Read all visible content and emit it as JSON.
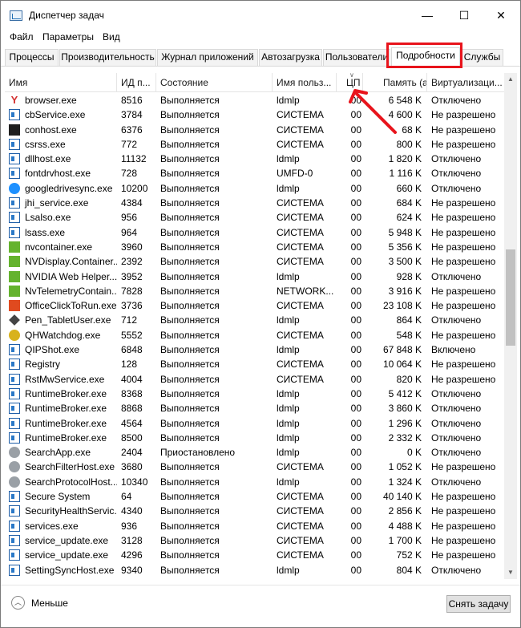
{
  "window": {
    "title": "Диспетчер задач",
    "close_glyph": "✕",
    "minimize_glyph": "—",
    "maximize_glyph": "☐"
  },
  "menu": [
    "Файл",
    "Параметры",
    "Вид"
  ],
  "tabs": [
    {
      "label": "Процессы"
    },
    {
      "label": "Производительность"
    },
    {
      "label": "Журнал приложений"
    },
    {
      "label": "Автозагрузка"
    },
    {
      "label": "Пользователи"
    },
    {
      "label": "Подробности",
      "active": true
    },
    {
      "label": "Службы"
    }
  ],
  "highlight_color": "#e8141c",
  "columns": {
    "name": "Имя",
    "pid": "ИД п...",
    "status": "Состояние",
    "user": "Имя польз...",
    "cpu": "ЦП",
    "memory": "Память (а...",
    "virt": "Виртуализаци..."
  },
  "processes": [
    {
      "icon": "yandex-browser-icon",
      "name": "browser.exe",
      "pid": "8516",
      "status": "Выполняется",
      "user": "ldmlp",
      "cpu": "00",
      "mem": "6 548 K",
      "virt": "Отключено"
    },
    {
      "icon": "exe-icon",
      "name": "cbService.exe",
      "pid": "3784",
      "status": "Выполняется",
      "user": "СИСТЕМА",
      "cpu": "00",
      "mem": "4 600 K",
      "virt": "Не разрешено"
    },
    {
      "icon": "console-icon",
      "name": "conhost.exe",
      "pid": "6376",
      "status": "Выполняется",
      "user": "СИСТЕМА",
      "cpu": "00",
      "mem": "68 K",
      "virt": "Не разрешено"
    },
    {
      "icon": "exe-icon",
      "name": "csrss.exe",
      "pid": "772",
      "status": "Выполняется",
      "user": "СИСТЕМА",
      "cpu": "00",
      "mem": "800 K",
      "virt": "Не разрешено"
    },
    {
      "icon": "exe-icon",
      "name": "dllhost.exe",
      "pid": "11132",
      "status": "Выполняется",
      "user": "ldmlp",
      "cpu": "00",
      "mem": "1 820 K",
      "virt": "Отключено"
    },
    {
      "icon": "exe-icon",
      "name": "fontdrvhost.exe",
      "pid": "728",
      "status": "Выполняется",
      "user": "UMFD-0",
      "cpu": "00",
      "mem": "1 116 K",
      "virt": "Отключено"
    },
    {
      "icon": "google-drive-icon",
      "name": "googledrivesync.exe",
      "pid": "10200",
      "status": "Выполняется",
      "user": "ldmlp",
      "cpu": "00",
      "mem": "660 K",
      "virt": "Отключено"
    },
    {
      "icon": "exe-icon",
      "name": "jhi_service.exe",
      "pid": "4384",
      "status": "Выполняется",
      "user": "СИСТЕМА",
      "cpu": "00",
      "mem": "684 K",
      "virt": "Не разрешено"
    },
    {
      "icon": "exe-icon",
      "name": "Lsalso.exe",
      "pid": "956",
      "status": "Выполняется",
      "user": "СИСТЕМА",
      "cpu": "00",
      "mem": "624 K",
      "virt": "Не разрешено"
    },
    {
      "icon": "exe-icon",
      "name": "lsass.exe",
      "pid": "964",
      "status": "Выполняется",
      "user": "СИСТЕМА",
      "cpu": "00",
      "mem": "5 948 K",
      "virt": "Не разрешено"
    },
    {
      "icon": "nvidia-icon",
      "name": "nvcontainer.exe",
      "pid": "3960",
      "status": "Выполняется",
      "user": "СИСТЕМА",
      "cpu": "00",
      "mem": "5 356 K",
      "virt": "Не разрешено"
    },
    {
      "icon": "nvidia-icon",
      "name": "NVDisplay.Container...",
      "pid": "2392",
      "status": "Выполняется",
      "user": "СИСТЕМА",
      "cpu": "00",
      "mem": "3 500 K",
      "virt": "Не разрешено"
    },
    {
      "icon": "nvidia-icon",
      "name": "NVIDIA Web Helper....",
      "pid": "3952",
      "status": "Выполняется",
      "user": "ldmlp",
      "cpu": "00",
      "mem": "928 K",
      "virt": "Отключено"
    },
    {
      "icon": "nvidia-icon",
      "name": "NvTelemetryContain...",
      "pid": "7828",
      "status": "Выполняется",
      "user": "NETWORK...",
      "cpu": "00",
      "mem": "3 916 K",
      "virt": "Не разрешено"
    },
    {
      "icon": "office-icon",
      "name": "OfficeClickToRun.exe",
      "pid": "3736",
      "status": "Выполняется",
      "user": "СИСТЕМА",
      "cpu": "00",
      "mem": "23 108 K",
      "virt": "Не разрешено"
    },
    {
      "icon": "pen-icon",
      "name": "Pen_TabletUser.exe",
      "pid": "712",
      "status": "Выполняется",
      "user": "ldmlp",
      "cpu": "00",
      "mem": "864 K",
      "virt": "Отключено"
    },
    {
      "icon": "qh-watchdog-icon",
      "name": "QHWatchdog.exe",
      "pid": "5552",
      "status": "Выполняется",
      "user": "СИСТЕМА",
      "cpu": "00",
      "mem": "548 K",
      "virt": "Не разрешено"
    },
    {
      "icon": "qipshot-icon",
      "name": "QIPShot.exe",
      "pid": "6848",
      "status": "Выполняется",
      "user": "ldmlp",
      "cpu": "00",
      "mem": "67 848 K",
      "virt": "Включено"
    },
    {
      "icon": "exe-icon",
      "name": "Registry",
      "pid": "128",
      "status": "Выполняется",
      "user": "СИСТЕМА",
      "cpu": "00",
      "mem": "10 064 K",
      "virt": "Не разрешено"
    },
    {
      "icon": "exe-icon",
      "name": "RstMwService.exe",
      "pid": "4004",
      "status": "Выполняется",
      "user": "СИСТЕМА",
      "cpu": "00",
      "mem": "820 K",
      "virt": "Не разрешено"
    },
    {
      "icon": "exe-icon",
      "name": "RuntimeBroker.exe",
      "pid": "8368",
      "status": "Выполняется",
      "user": "ldmlp",
      "cpu": "00",
      "mem": "5 412 K",
      "virt": "Отключено"
    },
    {
      "icon": "exe-icon",
      "name": "RuntimeBroker.exe",
      "pid": "8868",
      "status": "Выполняется",
      "user": "ldmlp",
      "cpu": "00",
      "mem": "3 860 K",
      "virt": "Отключено"
    },
    {
      "icon": "exe-icon",
      "name": "RuntimeBroker.exe",
      "pid": "4564",
      "status": "Выполняется",
      "user": "ldmlp",
      "cpu": "00",
      "mem": "1 296 K",
      "virt": "Отключено"
    },
    {
      "icon": "exe-icon",
      "name": "RuntimeBroker.exe",
      "pid": "8500",
      "status": "Выполняется",
      "user": "ldmlp",
      "cpu": "00",
      "mem": "2 332 K",
      "virt": "Отключено"
    },
    {
      "icon": "search-icon",
      "name": "SearchApp.exe",
      "pid": "2404",
      "status": "Приостановлено",
      "user": "ldmlp",
      "cpu": "00",
      "mem": "0 K",
      "virt": "Отключено"
    },
    {
      "icon": "search-icon",
      "name": "SearchFilterHost.exe",
      "pid": "3680",
      "status": "Выполняется",
      "user": "СИСТЕМА",
      "cpu": "00",
      "mem": "1 052 K",
      "virt": "Не разрешено"
    },
    {
      "icon": "search-icon",
      "name": "SearchProtocolHost....",
      "pid": "10340",
      "status": "Выполняется",
      "user": "ldmlp",
      "cpu": "00",
      "mem": "1 324 K",
      "virt": "Отключено"
    },
    {
      "icon": "exe-icon",
      "name": "Secure System",
      "pid": "64",
      "status": "Выполняется",
      "user": "СИСТЕМА",
      "cpu": "00",
      "mem": "40 140 K",
      "virt": "Не разрешено"
    },
    {
      "icon": "exe-icon",
      "name": "SecurityHealthServic...",
      "pid": "4340",
      "status": "Выполняется",
      "user": "СИСТЕМА",
      "cpu": "00",
      "mem": "2 856 K",
      "virt": "Не разрешено"
    },
    {
      "icon": "exe-icon",
      "name": "services.exe",
      "pid": "936",
      "status": "Выполняется",
      "user": "СИСТЕМА",
      "cpu": "00",
      "mem": "4 488 K",
      "virt": "Не разрешено"
    },
    {
      "icon": "exe-icon",
      "name": "service_update.exe",
      "pid": "3128",
      "status": "Выполняется",
      "user": "СИСТЕМА",
      "cpu": "00",
      "mem": "1 700 K",
      "virt": "Не разрешено"
    },
    {
      "icon": "exe-icon",
      "name": "service_update.exe",
      "pid": "4296",
      "status": "Выполняется",
      "user": "СИСТЕМА",
      "cpu": "00",
      "mem": "752 K",
      "virt": "Не разрешено"
    },
    {
      "icon": "exe-icon",
      "name": "SettingSyncHost.exe",
      "pid": "9340",
      "status": "Выполняется",
      "user": "ldmlp",
      "cpu": "00",
      "mem": "804 K",
      "virt": "Отключено"
    }
  ],
  "footer": {
    "less_label": "Меньше",
    "end_task_label": "Снять задачу"
  }
}
